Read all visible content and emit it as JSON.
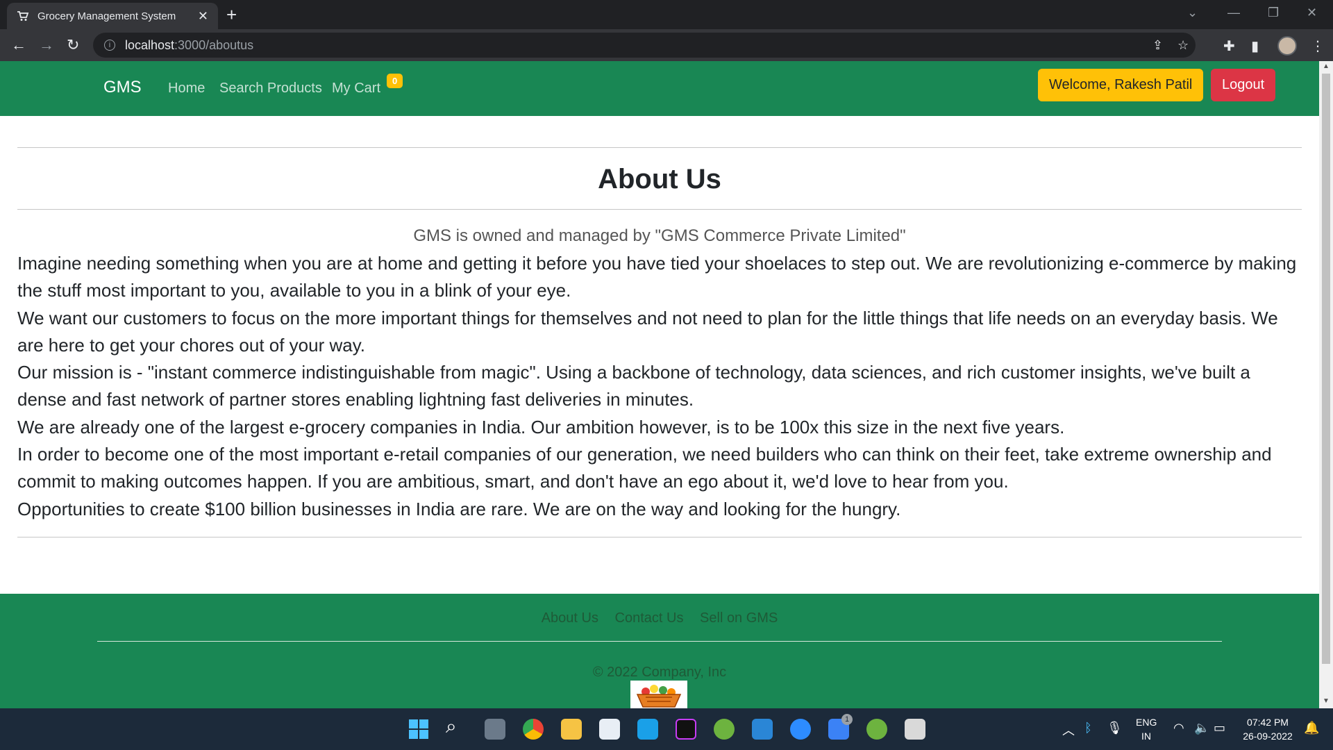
{
  "browser": {
    "tab_title": "Grocery Management System",
    "url_host": "localhost",
    "url_path": ":3000/aboutus"
  },
  "navbar": {
    "brand": "GMS",
    "links": [
      "Home",
      "Search Products",
      "My Cart"
    ],
    "cart_count": "0",
    "welcome": "Welcome, Rakesh Patil",
    "logout": "Logout"
  },
  "content": {
    "heading": "About Us",
    "lead": "GMS is owned and managed by \"GMS Commerce Private Limited\"",
    "paragraphs": [
      "Imagine needing something when you are at home and getting it before you have tied your shoelaces to step out. We are revolutionizing e-commerce by making the stuff most important to you, available to you in a blink of your eye.",
      "We want our customers to focus on the more important things for themselves and not need to plan for the little things that life needs on an everyday basis. We are here to get your chores out of your way.",
      "Our mission is - \"instant commerce indistinguishable from magic\". Using a backbone of technology, data sciences, and rich customer insights, we've built a dense and fast network of partner stores enabling lightning fast deliveries in minutes.",
      "We are already one of the largest e-grocery companies in India. Our ambition however, is to be 100x this size in the next five years.",
      "In order to become one of the most important e-retail companies of our generation, we need builders who can think on their feet, take extreme ownership and commit to making outcomes happen. If you are ambitious, smart, and don't have an ego about it, we'd love to hear from you.",
      "Opportunities to create $100 billion businesses in India are rare. We are on the way and looking for the hungry."
    ]
  },
  "footer": {
    "links": [
      "About Us",
      "Contact Us",
      "Sell on GMS"
    ],
    "copyright": "© 2022 Company, Inc"
  },
  "taskbar": {
    "lang": "ENG",
    "region": "IN",
    "time": "07:42 PM",
    "date": "26-09-2022",
    "notification_badge": "1"
  },
  "colors": {
    "navbar": "#198754",
    "warning": "#ffc107",
    "danger": "#dc3545"
  }
}
